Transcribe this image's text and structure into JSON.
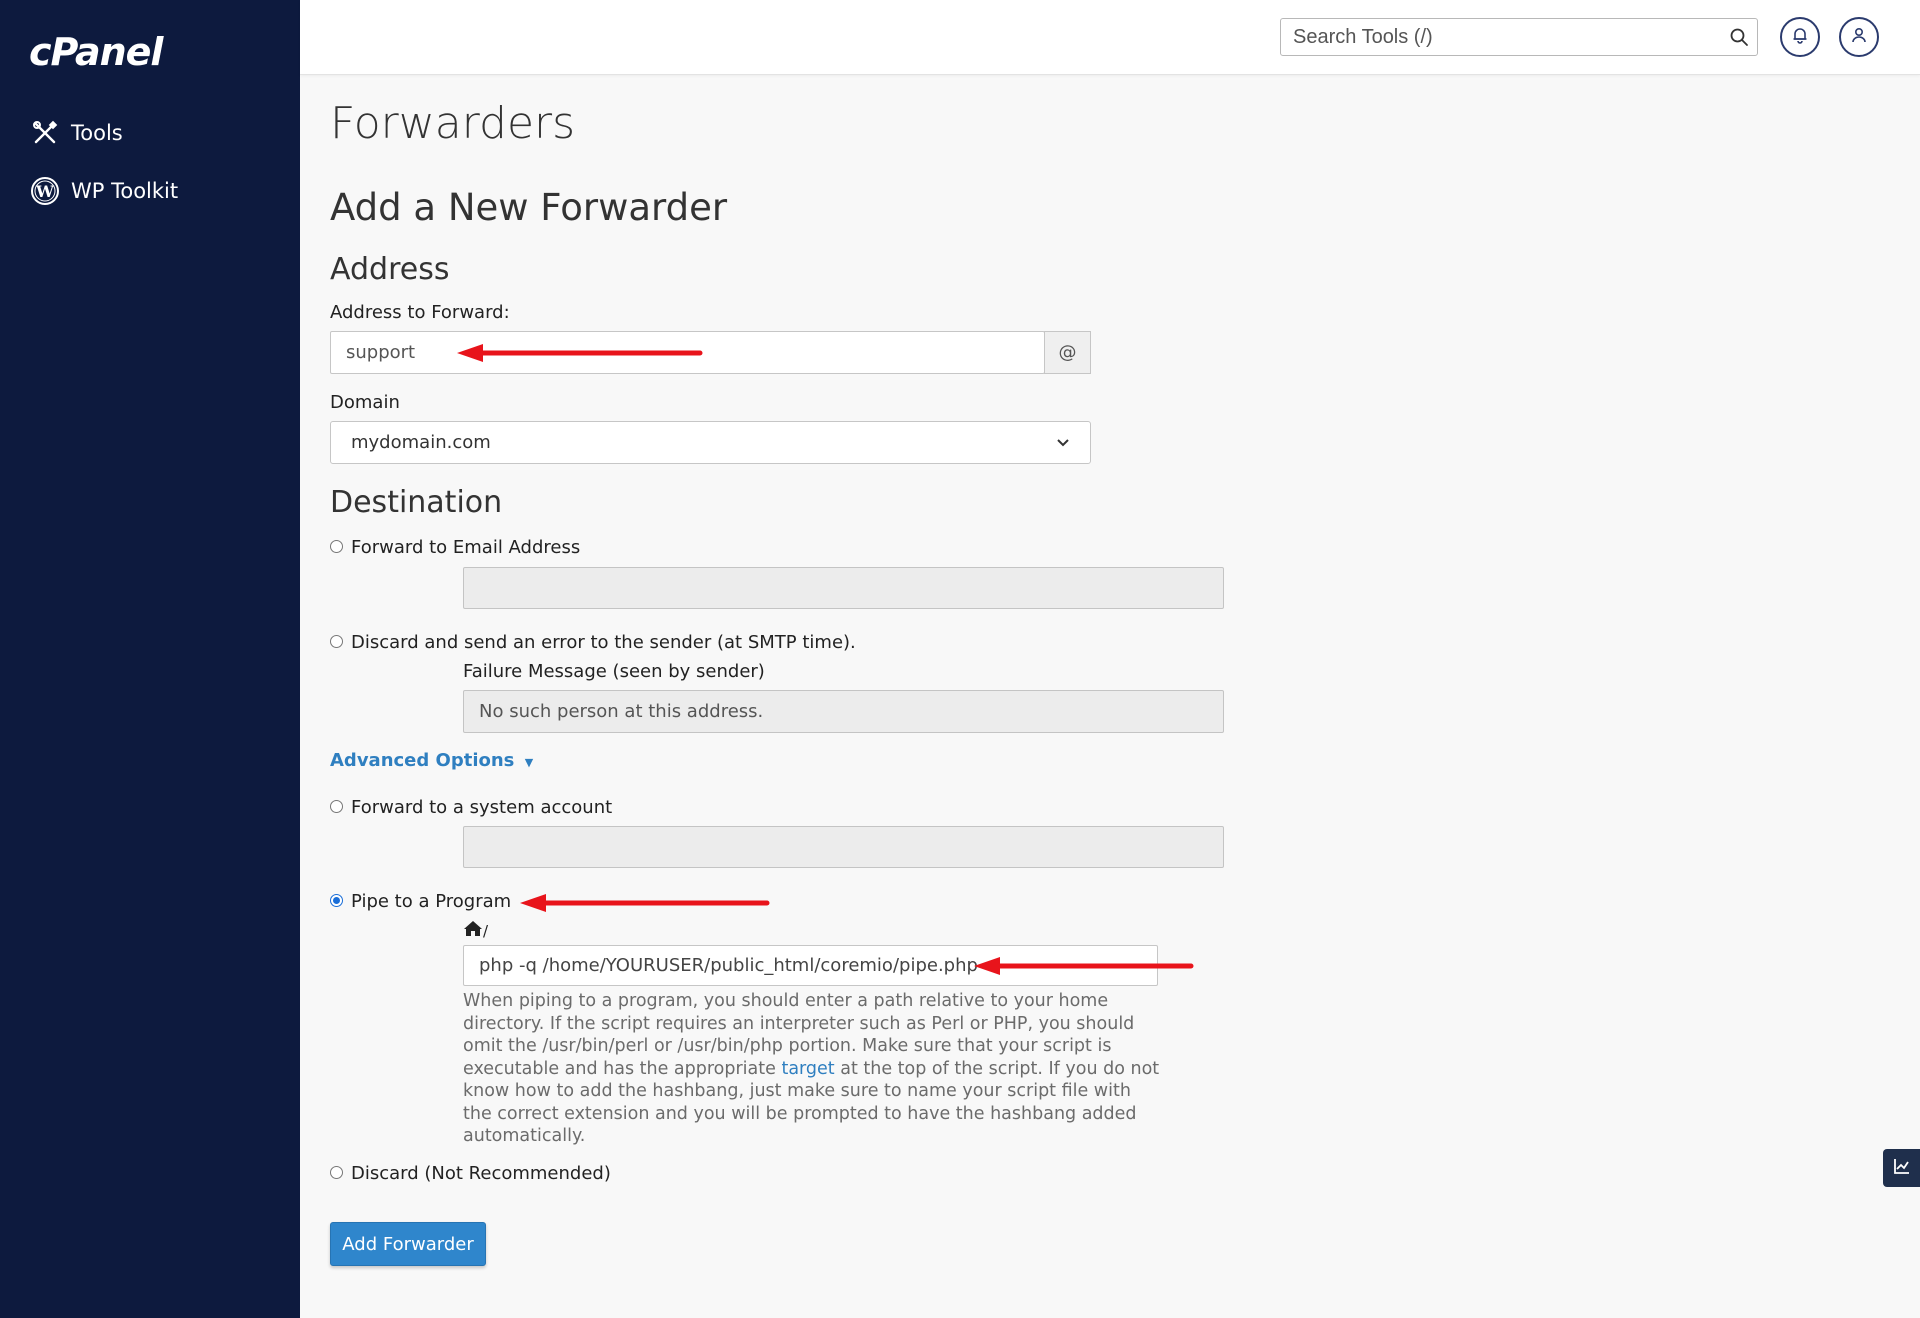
{
  "brand": {
    "logo_text": "cPanel"
  },
  "sidebar": {
    "items": [
      {
        "label": "Tools",
        "icon": "tools-icon"
      },
      {
        "label": "WP Toolkit",
        "icon": "wordpress-icon"
      }
    ]
  },
  "topbar": {
    "search_placeholder": "Search Tools (/)"
  },
  "page": {
    "title": "Forwarders",
    "subtitle": "Add a New Forwarder"
  },
  "address_section": {
    "heading": "Address",
    "address_label": "Address to Forward:",
    "address_value": "support",
    "at_symbol": "@",
    "domain_label": "Domain",
    "domain_value": "mydomain.com"
  },
  "destination": {
    "heading": "Destination",
    "forward_email_label": "Forward to Email Address",
    "discard_error_label": "Discard and send an error to the sender (at SMTP time).",
    "failure_message_label": "Failure Message (seen by sender)",
    "failure_message_value": "No such person at this address.",
    "advanced_options_label": "Advanced Options",
    "system_account_label": "Forward to a system account",
    "pipe_label": "Pipe to a Program",
    "pipe_path_prefix": "/",
    "pipe_value": "php -q /home/YOURUSER/public_html/coremio/pipe.php",
    "help_text_1": "When piping to a program, you should enter a path relative to your home directory. If the script requires an interpreter such as Perl or PHP, you should omit the /usr/bin/perl or /usr/bin/php portion. Make sure that your script is executable and has the appropriate ",
    "help_link": "target",
    "help_text_2": " at the top of the script. If you do not know how to add the hashbang, just make sure to name your script file with the correct extension and you will be prompted to have the hashbang added automatically.",
    "discard_label": "Discard (Not Recommended)",
    "selected": "Pipe to a Program"
  },
  "actions": {
    "add_button": "Add Forwarder"
  },
  "colors": {
    "sidebar": "#0d1a3e",
    "primary": "#2f86cc",
    "link": "#2f7fc0",
    "annotation_arrow": "#e8141b"
  }
}
